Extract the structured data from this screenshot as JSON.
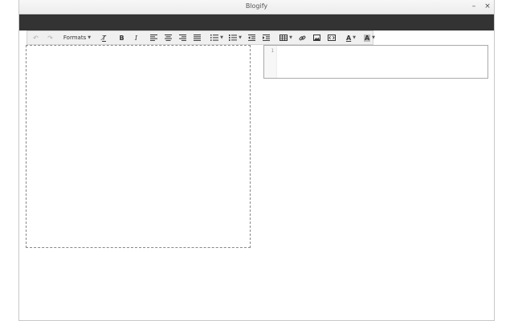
{
  "window": {
    "title": "Blogify",
    "minimize_label": "–",
    "close_label": "×"
  },
  "toolbar": {
    "formats_label": "Formats",
    "buttons": [
      {
        "name": "undo",
        "glyph": "↶"
      },
      {
        "name": "redo",
        "glyph": "↷"
      },
      {
        "name": "clear-formatting",
        "glyph": "T̸"
      },
      {
        "name": "bold",
        "glyph": "B"
      },
      {
        "name": "italic",
        "glyph": "I"
      },
      {
        "name": "text-color",
        "glyph": "A"
      },
      {
        "name": "background-color",
        "glyph": "A"
      }
    ]
  },
  "code_editor": {
    "line_numbers": [
      "1"
    ]
  }
}
